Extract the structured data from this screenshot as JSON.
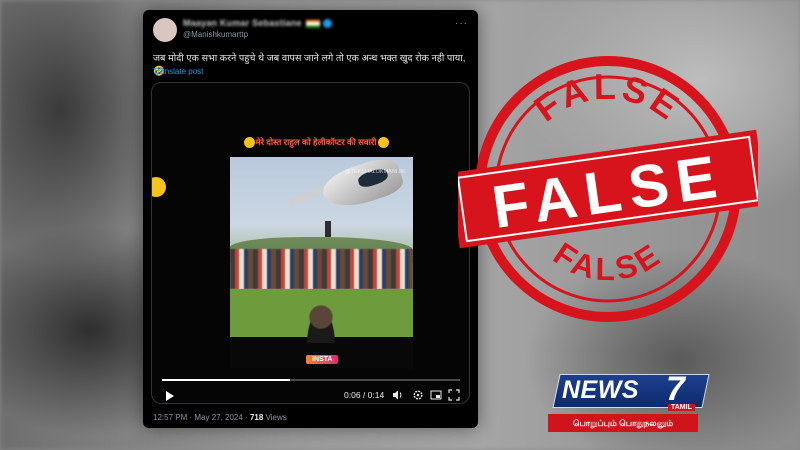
{
  "tweet": {
    "display_name": "Maayan Kumar Sebastiane",
    "handle": "@Manishkumarttp",
    "text": "जब मोदी एक सभा करने पहुचे थे जब वापस जाने लगे तो एक अन्ध भक्त खुद रोक नही पाया,🤣",
    "translate_label": "Translate post",
    "more_label": "···",
    "timestamp": "12:57 PM · May 27, 2024 · ",
    "views_count": "718",
    "views_label": " Views"
  },
  "video": {
    "caption": "मेरे दोस्त राहुल को हेलीकॉप्टर की सवारी",
    "watermark": "@TEKSHALOKMANI.86",
    "insta_badge": "INSTA",
    "current_time": "0:06",
    "duration": "0:14",
    "time_separator": " / ",
    "progress_fraction": 0.43,
    "controls": {
      "play_icon": "play-icon",
      "volume_icon": "volume-icon",
      "settings_icon": "gear-icon",
      "pip_icon": "picture-in-picture-icon",
      "fullscreen_icon": "fullscreen-icon"
    }
  },
  "stamp": {
    "main_word": "FALSE",
    "top_word": "FALSE",
    "bottom_word": "FALSE",
    "color": "#d7141c"
  },
  "news_logo": {
    "word": "NEWS",
    "number": "7",
    "badge": "TAMIL",
    "tagline": "பொறுப்பும் பொதுநலனும்",
    "blue": "#1d3f8f",
    "red": "#d0141c"
  }
}
